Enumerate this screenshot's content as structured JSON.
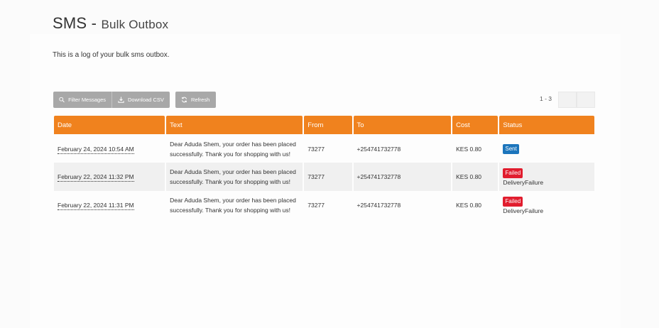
{
  "header": {
    "title": "SMS",
    "separator": " - ",
    "subtitle": "Bulk Outbox"
  },
  "description": "This is a log of your bulk sms outbox.",
  "toolbar": {
    "filter_label": "Filter Messages",
    "download_label": "Download CSV",
    "refresh_label": "Refresh"
  },
  "pagination": {
    "info": "1 - 3"
  },
  "table": {
    "columns": [
      "Date",
      "Text",
      "From",
      "To",
      "Cost",
      "Status"
    ],
    "rows": [
      {
        "date": "February 24, 2024 10:54 AM",
        "text": "Dear Aduda Shem, your order has been placed successfully. Thank you for shopping with us!",
        "from": "73277",
        "to": "+254741732778",
        "cost": "KES 0.80",
        "status": "Sent",
        "reason": ""
      },
      {
        "date": "February 22, 2024 11:32 PM",
        "text": "Dear Aduda Shem, your order has been placed successfully. Thank you for shopping with us!",
        "from": "73277",
        "to": "+254741732778",
        "cost": "KES 0.80",
        "status": "Failed",
        "reason": "DeliveryFailure"
      },
      {
        "date": "February 22, 2024 11:31 PM",
        "text": "Dear Aduda Shem, your order has been placed successfully. Thank you for shopping with us!",
        "from": "73277",
        "to": "+254741732778",
        "cost": "KES 0.80",
        "status": "Failed",
        "reason": "DeliveryFailure"
      }
    ]
  },
  "colors": {
    "header": "#f0821e",
    "sent": "#1c75bc",
    "failed": "#e11d2e",
    "button": "#a8a8a8"
  },
  "icons": {
    "filter": "search-icon",
    "download": "download-icon",
    "refresh": "refresh-icon"
  }
}
